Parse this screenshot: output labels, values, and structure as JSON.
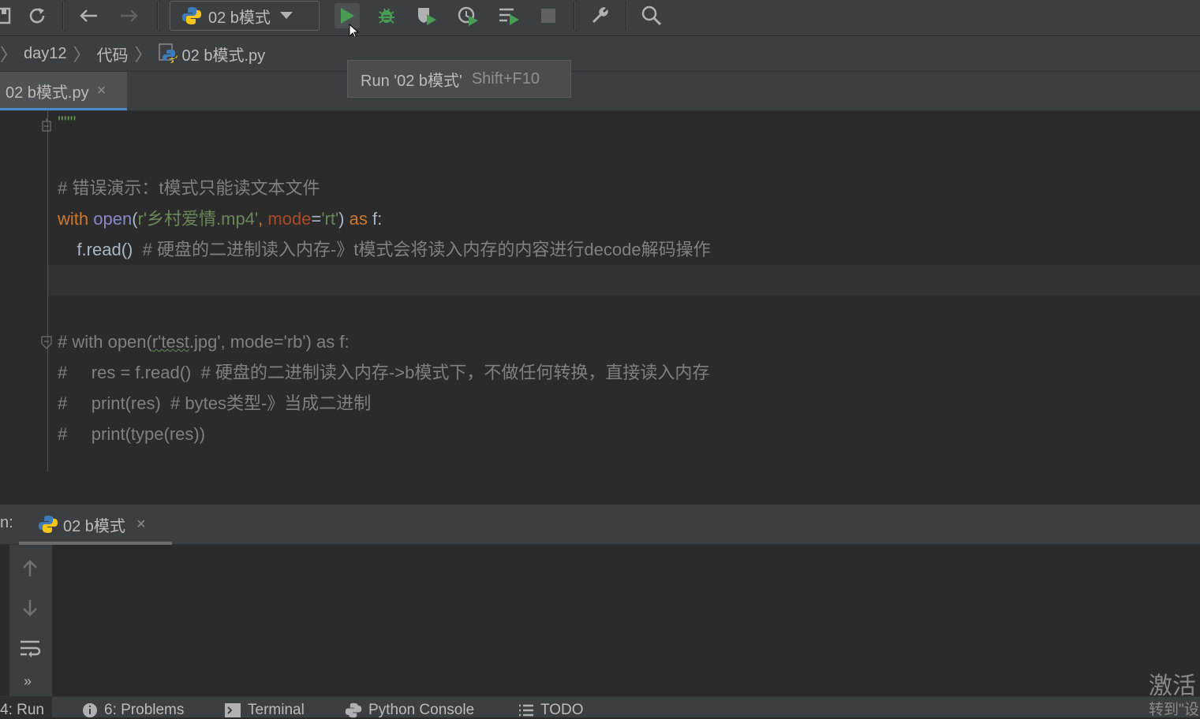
{
  "toolbar": {
    "run_config_label": "02 b模式"
  },
  "breadcrumb": {
    "items": [
      "day12",
      "代码",
      "02 b模式.py"
    ]
  },
  "tabs": {
    "active": "02 b模式.py",
    "close": "×"
  },
  "tooltip": {
    "text": "Run '02 b模式'",
    "shortcut": "Shift+F10"
  },
  "editor": {
    "line_doc_end": "\"\"\"",
    "comment_error": "# 错误演示：t模式只能读文本文件",
    "with": "with",
    "open": "open",
    "paren_open": "(",
    "str_file": "r'乡村爱情.mp4'",
    "comma": ", ",
    "mode_kw": "mode",
    "eq": "=",
    "str_mode": "'rt'",
    "paren_close": ")",
    "as": "as",
    "f_colon": "f:",
    "read_call": "f.read()",
    "read_comment": "# 硬盘的二进制读入内存-》t模式会将读入内存的内容进行decode解码操作",
    "c1_prefix": "# with open(",
    "c1_squig": "r'test",
    "c1_suffix": ".jpg', mode='rb') as f:",
    "c2": "#     res = f.read()  # 硬盘的二进制读入内存->b模式下，不做任何转换，直接读入内存",
    "c3": "#     print(res)  # bytes类型-》当成二进制",
    "c4": "#     print(type(res))"
  },
  "run_panel": {
    "label_prefix": "n:",
    "tab_name": "02 b模式",
    "close": "×"
  },
  "bottom_bar": {
    "run": "4: Run",
    "problems": "6: Problems",
    "terminal": "Terminal",
    "python_console": "Python Console",
    "todo": "TODO"
  },
  "watermark": {
    "line1": "激活",
    "line2": "转到\"设"
  },
  "colors": {
    "run_green": "#499c54",
    "accent_blue": "#4a88c7"
  }
}
